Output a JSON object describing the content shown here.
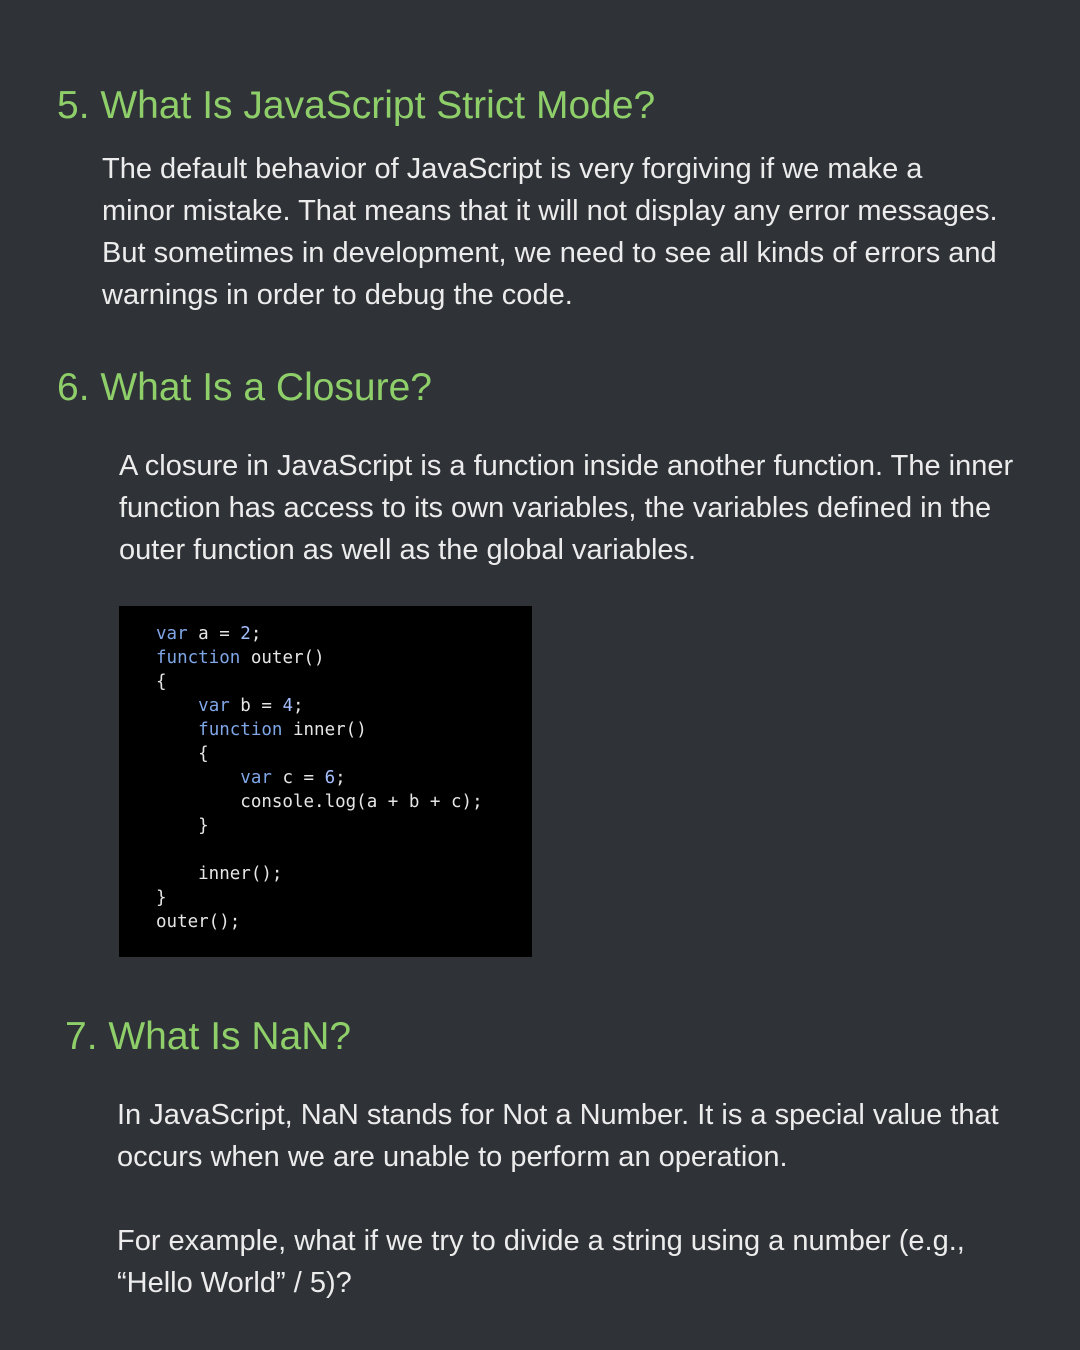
{
  "sections": [
    {
      "heading": "5. What Is JavaScript Strict Mode?",
      "paragraphs": [
        "The default behavior of JavaScript is very forgiving if we make a minor mistake. That means that it will not display any error messages. But sometimes in development, we need to see all kinds of errors and warnings in order to debug the code."
      ]
    },
    {
      "heading": "6. What Is a Closure?",
      "paragraphs": [
        "A closure in JavaScript is a function inside another function. The inner function has access to its own variables, the variables defined in the outer function as well as the global variables."
      ],
      "code": {
        "lines": [
          [
            {
              "t": "var",
              "c": "kw"
            },
            {
              "t": " a = "
            },
            {
              "t": "2",
              "c": "num"
            },
            {
              "t": ";"
            }
          ],
          [
            {
              "t": "function",
              "c": "kw"
            },
            {
              "t": " outer()"
            }
          ],
          [
            {
              "t": "{"
            }
          ],
          [
            {
              "t": "    "
            },
            {
              "t": "var",
              "c": "kw"
            },
            {
              "t": " b = "
            },
            {
              "t": "4",
              "c": "num"
            },
            {
              "t": ";"
            }
          ],
          [
            {
              "t": "    "
            },
            {
              "t": "function",
              "c": "kw"
            },
            {
              "t": " inner()"
            }
          ],
          [
            {
              "t": "    {"
            }
          ],
          [
            {
              "t": "        "
            },
            {
              "t": "var",
              "c": "kw"
            },
            {
              "t": " c = "
            },
            {
              "t": "6",
              "c": "num"
            },
            {
              "t": ";"
            }
          ],
          [
            {
              "t": "        console.log(a + b + c);"
            }
          ],
          [
            {
              "t": "    }"
            }
          ],
          [
            {
              "t": ""
            }
          ],
          [
            {
              "t": "    inner();"
            }
          ],
          [
            {
              "t": "}"
            }
          ],
          [
            {
              "t": "outer();"
            }
          ]
        ]
      }
    },
    {
      "heading": "7. What Is NaN?",
      "paragraphs": [
        "In JavaScript, NaN stands for Not a Number. It is a special value that occurs when we are unable to perform an operation.",
        "For example, what if we try to divide a string using a number (e.g., “Hello World” / 5)?"
      ]
    }
  ],
  "colors": {
    "background": "#2f3237",
    "heading": "#8fcf6a",
    "body_text": "#ececec",
    "code_background": "#000000",
    "code_keyword": "#7fa7e8"
  }
}
